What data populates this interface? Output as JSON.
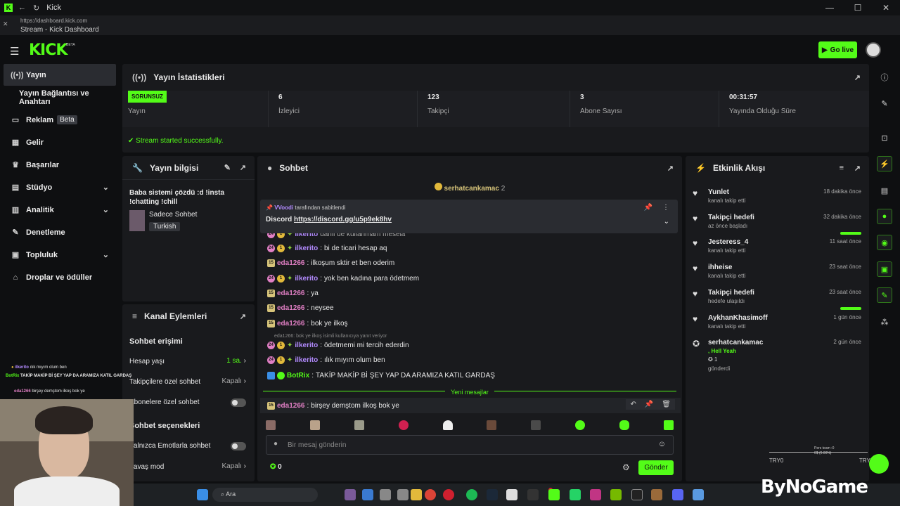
{
  "window": {
    "title": "Kick",
    "url": "https://dashboard.kick.com",
    "tab_title": "Stream - Kick Dashboard"
  },
  "header": {
    "logo": "KICK",
    "beta": "BETA",
    "go_live": "Go live"
  },
  "sidebar": {
    "items": [
      {
        "label": "Yayın",
        "icon": "broadcast-icon"
      },
      {
        "label": "Yayın Bağlantısı ve Anahtarı"
      },
      {
        "label": "Reklam",
        "badge": "Beta",
        "icon": "ad-icon"
      },
      {
        "label": "Gelir",
        "icon": "revenue-icon"
      },
      {
        "label": "Başarılar",
        "icon": "trophy-icon"
      },
      {
        "label": "Stüdyo",
        "icon": "studio-icon"
      },
      {
        "label": "Analitik",
        "icon": "analytics-icon"
      },
      {
        "label": "Denetleme",
        "icon": "moderation-icon"
      },
      {
        "label": "Topluluk",
        "icon": "community-icon"
      },
      {
        "label": "Droplar ve ödüller",
        "icon": "drops-icon"
      }
    ]
  },
  "stats": {
    "title": "Yayın İstatistikleri",
    "status_badge": "SORUNSUZ",
    "status_label": "Yayın",
    "cells": [
      {
        "value": "6",
        "label": "İzleyici"
      },
      {
        "value": "123",
        "label": "Takipçi"
      },
      {
        "value": "3",
        "label": "Abone Sayısı"
      },
      {
        "value": "00:31:57",
        "label": "Yayında Olduğu Süre"
      }
    ],
    "success": "Stream started successfully."
  },
  "info": {
    "title": "Yayın bilgisi",
    "stream_title": "Baba sistemi çözdü :d !insta !chatting !chill",
    "category": "Sadece Sohbet",
    "language": "Turkish"
  },
  "actions": {
    "title": "Kanal Eylemleri",
    "chat_access": "Sohbet erişimi",
    "account_age": "Hesap yaşı",
    "account_age_val": "1 sa.",
    "followers_only": "Takipçilere özel sohbet",
    "followers_only_val": "Kapalı",
    "subs_only": "Abonelere özel sohbet",
    "chat_options": "Sohbet seçenekleri",
    "emote_only": "Yalnızca Emotlarla sohbet",
    "slow_mode": "Yavaş mod",
    "slow_mode_val": "Kapalı"
  },
  "chat": {
    "title": "Sohbet",
    "gifter": "serhatcankamac",
    "gifter_count": "2",
    "pinned_by": "VVoodi",
    "pinned_suffix": "tarafından sabitlendi",
    "pinned_text": "Discord ",
    "pinned_link": "https://discord.gg/u5p9ek8hv",
    "partial": "dahil de kullanmam mesela",
    "messages": [
      {
        "user": "ilkerito",
        "text": "bi de ticari hesap aq",
        "type": "v"
      },
      {
        "user": "eda1266",
        "text": "ilkoşum sktir et ben oderim",
        "type": "p"
      },
      {
        "user": "ilkerito",
        "text": "yok ben kadına para ödetmem",
        "type": "v"
      },
      {
        "user": "eda1266",
        "text": "ya",
        "type": "p"
      },
      {
        "user": "eda1266",
        "text": "neysee",
        "type": "p"
      },
      {
        "user": "eda1266",
        "text": "bok ye ilkoş",
        "type": "p"
      }
    ],
    "reply_note": "eda1266: bok ye ilkoş isimli kullanıcıya yanıt veriyor",
    "messages2": [
      {
        "user": "ilkerito",
        "text": "ödetmemi mi tercih ederdin",
        "type": "v"
      },
      {
        "user": "ilkerito",
        "text": "ılık mıyım olum ben",
        "type": "v"
      },
      {
        "user": "BotRix",
        "text": "TAKİP MAKİP Bİ ŞEY YAP DA ARAMIZA KATIL GARDAŞ",
        "type": "g"
      }
    ],
    "new_messages": "Yeni mesajlar",
    "last": {
      "user": "eda1266",
      "text": "birşey demştom ilkoş bok ye"
    },
    "placeholder": "Bir mesaj gönderin",
    "points": "0",
    "send": "Gönder"
  },
  "events": {
    "title": "Etkinlik Akışı",
    "items": [
      {
        "name": "Yunlet",
        "sub": "kanalı takip etti",
        "time": "18 dakika önce"
      },
      {
        "name": "Takipçi hedefi",
        "sub": "az önce başladı",
        "time": "32 dakika önce",
        "bar": true
      },
      {
        "name": "Jesteress_4",
        "sub": "kanalı takip etti",
        "time": "11 saat önce"
      },
      {
        "name": "ihheise",
        "sub": "kanalı takip etti",
        "time": "23 saat önce"
      },
      {
        "name": "Takipçi hedefi",
        "sub": "hedefe ulaşıldı",
        "time": "23 saat önce",
        "bar": true
      },
      {
        "name": "AykhanKhasimoff",
        "sub": "kanalı takip etti",
        "time": "1 gün önce"
      },
      {
        "name": "serhatcankamac",
        "sub": "gönderdi",
        "time": "2 gün önce",
        "extra": "Hell Yeah",
        "extra_count": "1"
      }
    ]
  },
  "overlay": {
    "lines": [
      {
        "user": "ilkerito",
        "text": "ılık mıyım olum ben"
      },
      {
        "user": "BotRix",
        "text": "TAKİP MAKİP Bİ ŞEY YAP DA ARAMIZA KATIL GARDAŞ"
      },
      {
        "user": "eda1266",
        "text": "birşey demştom ilkoş bok ye"
      }
    ],
    "tr1": "TRY0",
    "tr2": "TRY",
    "pl": "Pers team :0",
    "pl2": "0$ (0.00%)"
  },
  "taskbar": {
    "search": "Ara"
  },
  "watermark": "ByNoGame"
}
